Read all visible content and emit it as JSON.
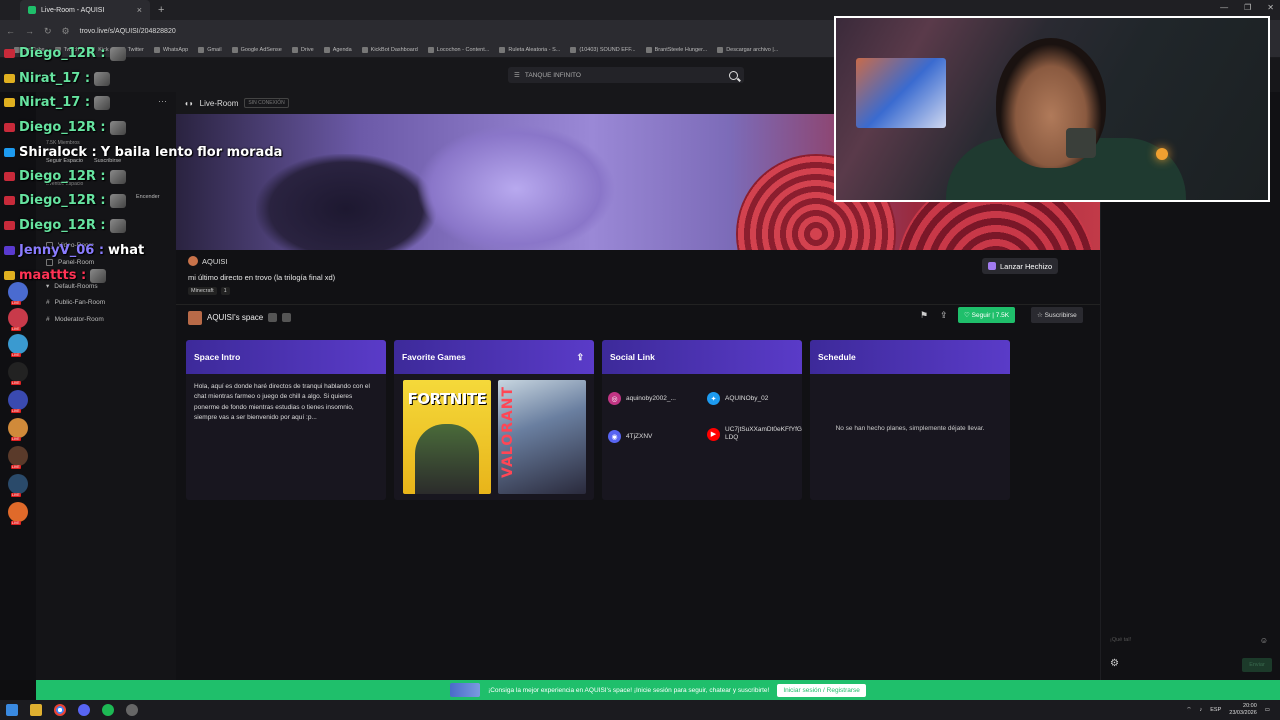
{
  "browser": {
    "tab_title": "Live-Room - AQUISI",
    "new_tab": "+",
    "url": "trovo.live/s/AQUISI/204828820",
    "bookmarks": [
      "YouTube",
      "Twitch",
      "Kick",
      "Twitter",
      "WhatsApp",
      "Gmail",
      "Google AdSense",
      "Drive",
      "Agenda",
      "KickBot Dashboard",
      "Locochon - Content...",
      "Ruleta Aleatoria - S...",
      "(10403) SOUND EFF...",
      "BrantSteele Hunger...",
      "Descargar archivo |..."
    ]
  },
  "search": {
    "placeholder": "TANQUE INFINITO"
  },
  "chat_overlay": [
    {
      "user": "Diego_12R :",
      "message": "",
      "user_color": "#66e3a0"
    },
    {
      "user": "Nirat_17 :",
      "message": "",
      "user_color": "#66e3a0"
    },
    {
      "user": "Nirat_17 :",
      "message": "",
      "user_color": "#66e3a0"
    },
    {
      "user": "Diego_12R :",
      "message": "",
      "user_color": "#66e3a0"
    },
    {
      "user": "Shiralock :",
      "message": "Y baila lento flor morada",
      "user_color": "#ffffff"
    },
    {
      "user": "Diego_12R :",
      "message": "",
      "user_color": "#66e3a0"
    },
    {
      "user": "Diego_12R :",
      "message": "",
      "user_color": "#66e3a0"
    },
    {
      "user": "Diego_12R :",
      "message": "",
      "user_color": "#66e3a0"
    },
    {
      "user": "JennyV_06 :",
      "message": "what",
      "user_color": "#8a7cff"
    },
    {
      "user": "maattts :",
      "message": "",
      "user_color": "#ff3355"
    }
  ],
  "room_sidebar": {
    "followers": "7.5K Miembros",
    "follow_space": "Seguir Espacio",
    "subscribe": "Suscribirse",
    "events": "Eventos Espacio",
    "turn_on": "Encender",
    "video_room": "Video-Room",
    "panel_room": "Panel-Room",
    "default_rooms": "Default-Rooms",
    "public_room": "Public-Fan-Room",
    "moderator_room": "Moderator-Room"
  },
  "room_header": {
    "title": "Live-Room",
    "status": "SIN CONEXIÓN"
  },
  "stream": {
    "streamer": "AQUISI",
    "title": "mi último directo en trovo (la trilogía final xd)",
    "category": "Minecraft",
    "category_count": "1"
  },
  "spell_button": "Lanzar Hechizo",
  "space": {
    "name": "AQUISI's space",
    "follow": "Seguir",
    "follow_count": "7.5K",
    "subscribe": "Suscribirse"
  },
  "panels": {
    "intro": {
      "title": "Space Intro",
      "body": "Hola, aquí es donde haré directos de tranqui hablando con el chat mientras farmeo o juego de chill a algo. Si quieres ponerme de fondo mientras estudias o tienes insomnio, siempre vas a ser bienvenido por aquí :p..."
    },
    "games": {
      "title": "Favorite Games",
      "game1": "FORTNITE",
      "game2": "VALORANT"
    },
    "social": {
      "title": "Social Link",
      "instagram": "aquinoby2002_...",
      "twitter": "AQUINOby_02",
      "discord": "4TjZXNV",
      "youtube": "UC7jtSuXXamDt0eKFfYfGLDQ"
    },
    "schedule": {
      "title": "Schedule",
      "empty": "No se han hecho planes, simplemente déjate llevar."
    }
  },
  "chat_input": {
    "placeholder": "¡Qué tal!",
    "send": "Enviar"
  },
  "promo": {
    "text": "¡Consiga la mejor experiencia en AQUISI's space! ¡Inicie sesión para seguir, chatear y suscribirte!",
    "login": "Iniciar sesión / Registrarse"
  },
  "taskbar": {
    "lang": "ESP",
    "time": "20:00",
    "date": "23/03/2026"
  },
  "colors": {
    "accent_green": "#1fbf6b",
    "panel_purple": "#5a3bc8",
    "background": "#111114"
  }
}
